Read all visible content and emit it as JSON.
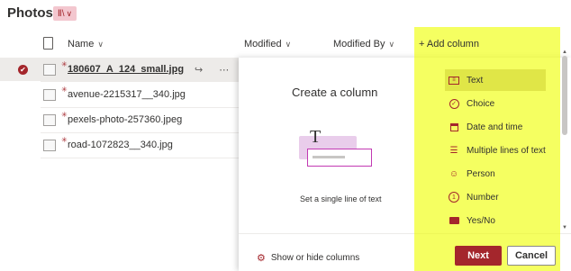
{
  "header": {
    "title": "Photos",
    "view_icon": "library-view-icon"
  },
  "columns": {
    "name": "Name",
    "modified": "Modified",
    "modified_by": "Modified By",
    "add_column": "+ Add column"
  },
  "files": [
    {
      "name": "180607_A_124_small.jpg",
      "selected": true
    },
    {
      "name": "avenue-2215317__340.jpg",
      "selected": false
    },
    {
      "name": "pexels-photo-257360.jpeg",
      "selected": false
    },
    {
      "name": "road-1072823__340.jpg",
      "selected": false
    }
  ],
  "panel": {
    "title": "Create a column",
    "illustration_letter": "T",
    "description": "Set a single line of text",
    "show_hide": "Show or hide columns",
    "next": "Next",
    "cancel": "Cancel"
  },
  "column_types": [
    {
      "label": "Text",
      "icon": "text-icon",
      "active": true
    },
    {
      "label": "Choice",
      "icon": "choice-icon",
      "active": false
    },
    {
      "label": "Date and time",
      "icon": "calendar-icon",
      "active": false
    },
    {
      "label": "Multiple lines of text",
      "icon": "multiline-icon",
      "active": false
    },
    {
      "label": "Person",
      "icon": "person-icon",
      "active": false
    },
    {
      "label": "Number",
      "icon": "number-icon",
      "active": false
    },
    {
      "label": "Yes/No",
      "icon": "yes-no-icon",
      "active": false
    }
  ],
  "colors": {
    "accent": "#a4262c",
    "highlight": "#efff00"
  }
}
